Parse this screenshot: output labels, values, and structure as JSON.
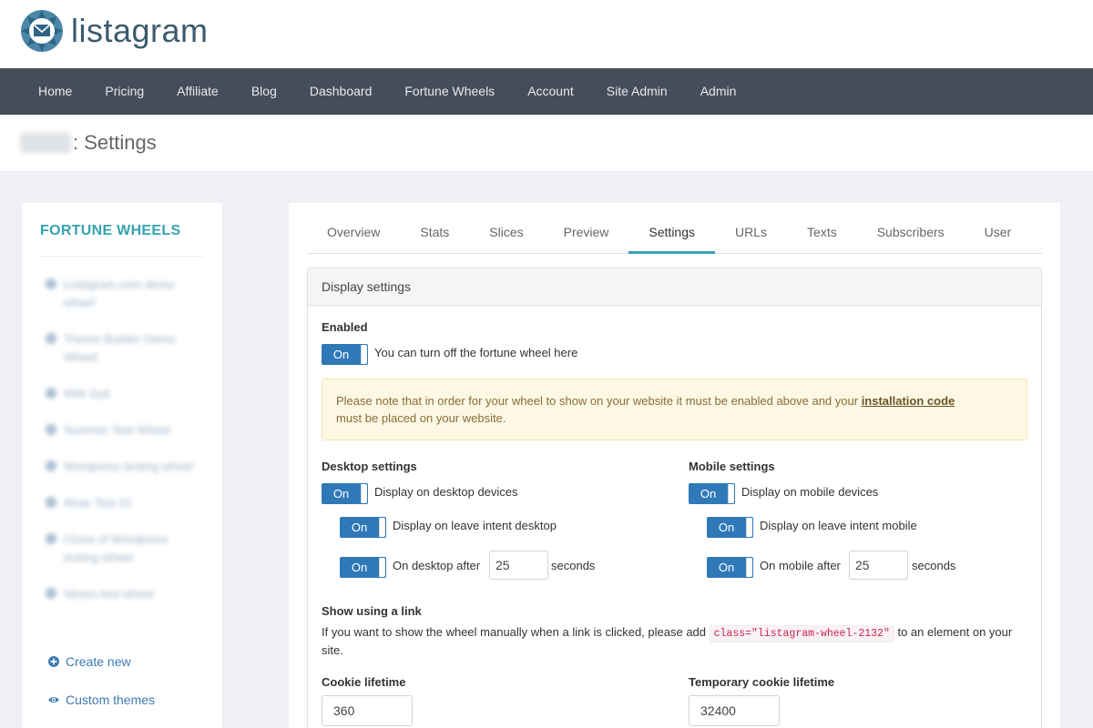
{
  "brand": {
    "name": "listagram"
  },
  "nav": {
    "items": [
      "Home",
      "Pricing",
      "Affiliate",
      "Blog",
      "Dashboard",
      "Fortune Wheels",
      "Account",
      "Site Admin",
      "Admin"
    ]
  },
  "page": {
    "title_suffix": ": Settings"
  },
  "sidebar": {
    "title": "FORTUNE WHEELS",
    "wheels": [
      "Listagram.com demo wheel",
      "Theme Builder Demo Wheel",
      "WW Syd",
      "Summer Test Wheel",
      "Wordpress testing wheel",
      "Ahas Test #2",
      "Clone of Wordpress testing wheel",
      "Stress test wheel"
    ],
    "create_new": "Create new",
    "custom_themes": "Custom themes"
  },
  "tabs": [
    "Overview",
    "Stats",
    "Slices",
    "Preview",
    "Settings",
    "URLs",
    "Texts",
    "Subscribers",
    "User"
  ],
  "active_tab": "Settings",
  "panel": {
    "title": "Display settings",
    "enabled": {
      "label": "Enabled",
      "toggle": "On",
      "text": "You can turn off the fortune wheel here"
    },
    "notice": {
      "before": "Please note that in order for your wheel to show on your website it must be enabled above and your ",
      "link": "installation code",
      "after": "must be placed on your website."
    },
    "desktop": {
      "title": "Desktop settings",
      "display": {
        "toggle": "On",
        "text": "Display on desktop devices"
      },
      "leave_intent": {
        "toggle": "On",
        "text": "Display on leave intent desktop"
      },
      "after": {
        "toggle": "On",
        "text": "On desktop after",
        "value": "25",
        "unit": "seconds"
      }
    },
    "mobile": {
      "title": "Mobile settings",
      "display": {
        "toggle": "On",
        "text": "Display on mobile devices"
      },
      "leave_intent": {
        "toggle": "On",
        "text": "Display on leave intent mobile"
      },
      "after": {
        "toggle": "On",
        "text": "On mobile after",
        "value": "25",
        "unit": "seconds"
      }
    },
    "link": {
      "title": "Show using a link",
      "before": "If you want to show the wheel manually when a link is clicked, please add ",
      "code": "class=\"listagram-wheel-2132\"",
      "after": " to an element on your site."
    },
    "cookie": {
      "label": "Cookie lifetime",
      "value": "360"
    },
    "temp_cookie": {
      "label": "Temporary cookie lifetime",
      "value": "32400"
    }
  },
  "colors": {
    "nav_bg": "#464d5a",
    "accent": "#36a3b1",
    "toggle": "#3079b8",
    "notice_bg": "#fcf8e3",
    "link": "#3c7ab3"
  }
}
